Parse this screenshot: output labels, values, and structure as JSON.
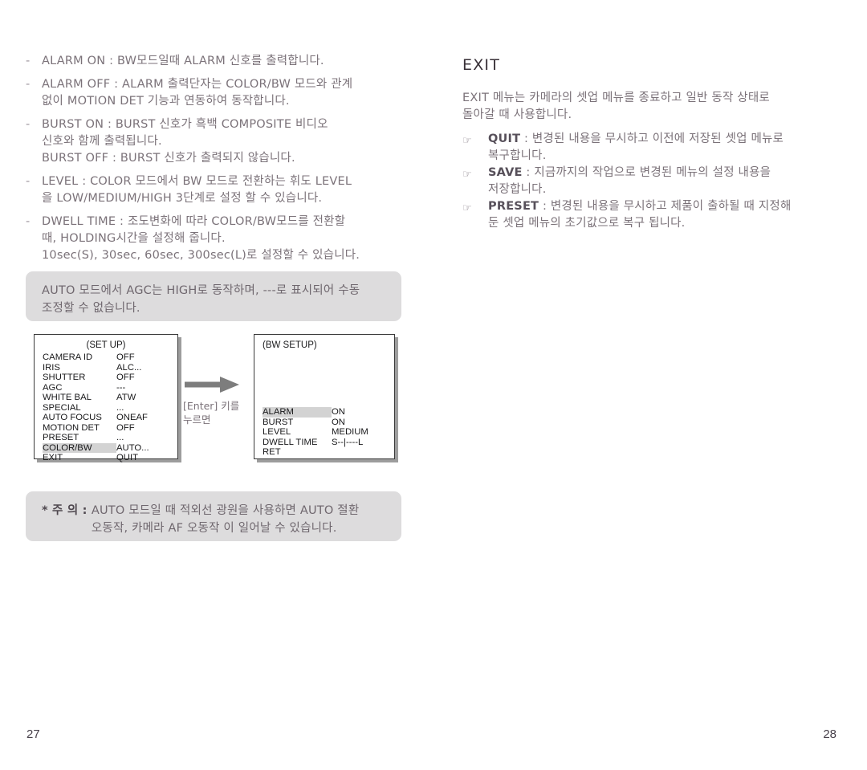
{
  "left_page": {
    "bullets": [
      {
        "marker": "-",
        "text": "ALARM ON : BW모드일때 ALARM 신호를 출력합니다."
      },
      {
        "marker": "-",
        "text": "ALARM OFF : ALARM 출력단자는 COLOR/BW 모드와 관계\n없이 MOTION DET 기능과 연동하여 동작합니다."
      },
      {
        "marker": "-",
        "text": "BURST ON  : BURST 신호가 흑백 COMPOSITE 비디오\n신호와 함께 출력됩니다.\nBURST OFF : BURST 신호가 출력되지 않습니다."
      },
      {
        "marker": "-",
        "text": "LEVEL : COLOR 모드에서 BW 모드로 전환하는 휘도 LEVEL\n을 LOW/MEDIUM/HIGH 3단계로 설정 할 수 있습니다."
      },
      {
        "marker": "-",
        "text": "DWELL TIME : 조도변화에 따라 COLOR/BW모드를 전환할\n때, HOLDING시간을 설정해 줍니다.\n10sec(S), 30sec, 60sec, 300sec(L)로 설정할 수 있습니다."
      }
    ],
    "note_agc": "AUTO 모드에서 AGC는 HIGH로 동작하며, ---로 표시되어 수동\n조정할 수 없습니다.",
    "note_caution_label": "* 주 의 : ",
    "note_caution_text": "AUTO 모드일 때 적외선 광원을 사용하면 AUTO 절환\n오동작, 카메라 AF 오동작 이 일어날 수 있습니다.",
    "arrow_caption": "[Enter] 키를\n누르면",
    "osd_setup": {
      "title": "(SET UP)",
      "rows": [
        {
          "label": "CAMERA ID",
          "value": "OFF",
          "highlight": false
        },
        {
          "label": "IRIS",
          "value": "ALC...",
          "highlight": false
        },
        {
          "label": "SHUTTER",
          "value": "OFF",
          "highlight": false
        },
        {
          "label": "AGC",
          "value": "---",
          "highlight": false
        },
        {
          "label": "WHITE BAL",
          "value": "ATW",
          "highlight": false
        },
        {
          "label": "SPECIAL",
          "value": "...",
          "highlight": false
        },
        {
          "label": "AUTO FOCUS",
          "value": "ONEAF",
          "highlight": false
        },
        {
          "label": "MOTION DET",
          "value": "OFF",
          "highlight": false
        },
        {
          "label": "PRESET",
          "value": "...",
          "highlight": false
        },
        {
          "label": "COLOR/BW",
          "value": "AUTO...",
          "highlight": true
        },
        {
          "label": "EXIT",
          "value": "QUIT",
          "highlight": false
        }
      ]
    },
    "osd_bw": {
      "title": "(BW SETUP)",
      "rows": [
        {
          "label": "ALARM",
          "value": "ON",
          "highlight": true
        },
        {
          "label": "BURST",
          "value": "ON",
          "highlight": false
        },
        {
          "label": "LEVEL",
          "value": "MEDIUM",
          "highlight": false
        },
        {
          "label": "DWELL TIME",
          "value": "S--|----L",
          "highlight": false
        },
        {
          "label": "RET",
          "value": "",
          "highlight": false
        }
      ]
    },
    "page_number": "27"
  },
  "right_page": {
    "heading": "EXIT",
    "intro": "EXIT 메뉴는 카메라의 셋업 메뉴를 종료하고 일반 동작 상태로\n돌아갈 때 사용합니다.",
    "items": [
      {
        "icon": "☞",
        "key": "QUIT",
        "text": " : 변경된 내용을 무시하고 이전에 저장된 셋업 메뉴로\n복구합니다."
      },
      {
        "icon": "☞",
        "key": "SAVE",
        "text": " : 지금까지의 작업으로 변경된 메뉴의 설정 내용을\n저장합니다."
      },
      {
        "icon": "☞",
        "key": "PRESET",
        "text": " : 변경된 내용을 무시하고 제품이 출하될 때 지정해\n둔 셋업 메뉴의 초기값으로 복구 됩니다."
      }
    ],
    "page_number": "28"
  },
  "colors": {
    "body_text": "#7b7279",
    "heading_text": "#393138",
    "note_box_bg": "#dddcdd",
    "osd_border": "#3a3a3a",
    "osd_shadow": "#9d9d9d",
    "osd_highlight": "#d3d3d3",
    "arrow": "#7d7d7d"
  }
}
